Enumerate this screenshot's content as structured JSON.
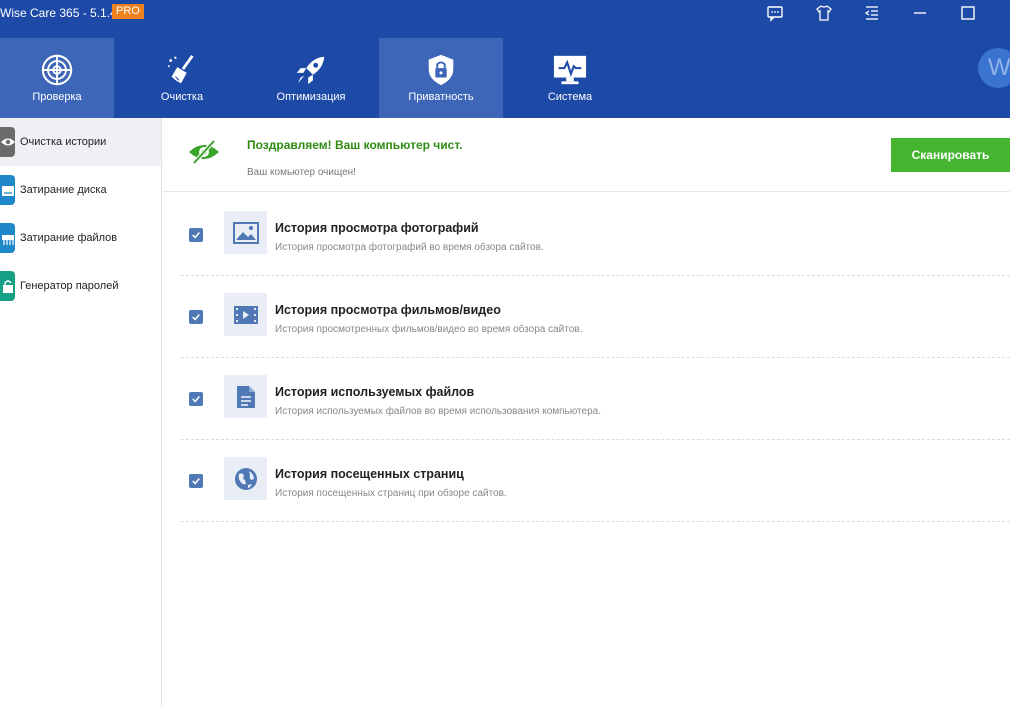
{
  "app": {
    "title": "Wise Care 365 - 5.1.4",
    "badge": "PRO",
    "avatar_letter": "W"
  },
  "titlebar_icons": [
    "feedback-icon",
    "skin-icon",
    "menu-icon",
    "minimize-icon",
    "maximize-icon"
  ],
  "nav": {
    "items": [
      {
        "label": "Проверка",
        "icon": "radar-icon"
      },
      {
        "label": "Очистка",
        "icon": "broom-icon"
      },
      {
        "label": "Оптимизация",
        "icon": "rocket-icon"
      },
      {
        "label": "Приватность",
        "icon": "shield-lock-icon"
      },
      {
        "label": "Система",
        "icon": "monitor-icon"
      }
    ],
    "active": "Приватность"
  },
  "sidebar": {
    "items": [
      {
        "label": "Очистка истории",
        "icon": "eye-icon",
        "color": "#6b6b6b"
      },
      {
        "label": "Затирание диска",
        "icon": "disk-icon",
        "color": "#1e88c9"
      },
      {
        "label": "Затирание файлов",
        "icon": "shredder-icon",
        "color": "#1e88c9"
      },
      {
        "label": "Генератор паролей",
        "icon": "lock-icon",
        "color": "#16a085"
      }
    ],
    "active": "Очистка истории"
  },
  "status": {
    "title": "Поздравляем! Ваш компьютер чист.",
    "subtitle": "Ваш комьютер очищен!",
    "scan_button": "Сканировать"
  },
  "history_items": [
    {
      "title": "История просмотра фотографий",
      "description": "История просмотра фотографий во время обзора сайтов.",
      "checked": true,
      "icon": "image-icon"
    },
    {
      "title": "История просмотра фильмов/видео",
      "description": "История просмотренных фильмов/видео во время обзора сайтов.",
      "checked": true,
      "icon": "film-icon"
    },
    {
      "title": "История используемых файлов",
      "description": "История используемых файлов во время использования компьютера.",
      "checked": true,
      "icon": "document-icon"
    },
    {
      "title": "История посещенных страниц",
      "description": "История посещенных страниц при обзоре сайтов.",
      "checked": true,
      "icon": "globe-icon"
    }
  ],
  "colors": {
    "header": "#1c4aa6",
    "nav_active": "#3d66b8",
    "success_text": "#2e8b12",
    "scan_button": "#45b530",
    "checkbox": "#4f78b5"
  }
}
